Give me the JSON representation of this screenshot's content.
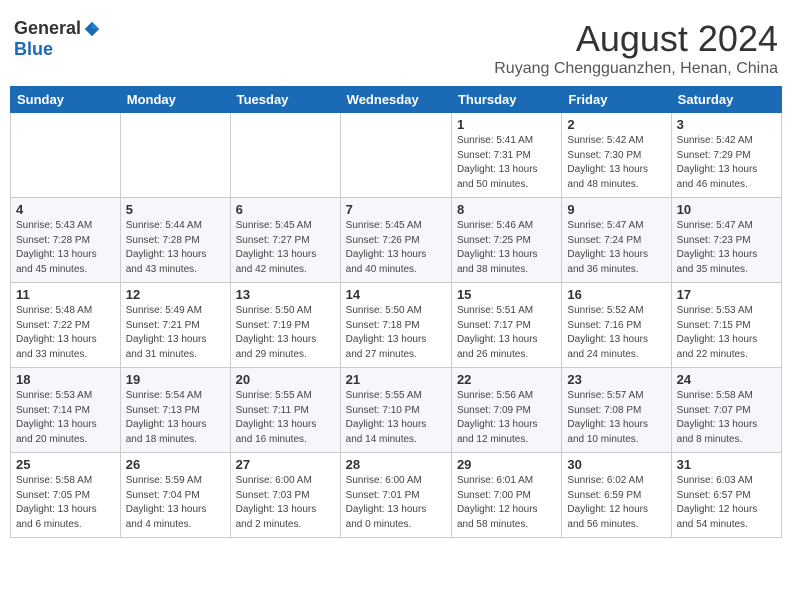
{
  "header": {
    "logo_general": "General",
    "logo_blue": "Blue",
    "month_title": "August 2024",
    "location": "Ruyang Chengguanzhen, Henan, China"
  },
  "days_of_week": [
    "Sunday",
    "Monday",
    "Tuesday",
    "Wednesday",
    "Thursday",
    "Friday",
    "Saturday"
  ],
  "weeks": [
    [
      {
        "day": "",
        "info": ""
      },
      {
        "day": "",
        "info": ""
      },
      {
        "day": "",
        "info": ""
      },
      {
        "day": "",
        "info": ""
      },
      {
        "day": "1",
        "info": "Sunrise: 5:41 AM\nSunset: 7:31 PM\nDaylight: 13 hours\nand 50 minutes."
      },
      {
        "day": "2",
        "info": "Sunrise: 5:42 AM\nSunset: 7:30 PM\nDaylight: 13 hours\nand 48 minutes."
      },
      {
        "day": "3",
        "info": "Sunrise: 5:42 AM\nSunset: 7:29 PM\nDaylight: 13 hours\nand 46 minutes."
      }
    ],
    [
      {
        "day": "4",
        "info": "Sunrise: 5:43 AM\nSunset: 7:28 PM\nDaylight: 13 hours\nand 45 minutes."
      },
      {
        "day": "5",
        "info": "Sunrise: 5:44 AM\nSunset: 7:28 PM\nDaylight: 13 hours\nand 43 minutes."
      },
      {
        "day": "6",
        "info": "Sunrise: 5:45 AM\nSunset: 7:27 PM\nDaylight: 13 hours\nand 42 minutes."
      },
      {
        "day": "7",
        "info": "Sunrise: 5:45 AM\nSunset: 7:26 PM\nDaylight: 13 hours\nand 40 minutes."
      },
      {
        "day": "8",
        "info": "Sunrise: 5:46 AM\nSunset: 7:25 PM\nDaylight: 13 hours\nand 38 minutes."
      },
      {
        "day": "9",
        "info": "Sunrise: 5:47 AM\nSunset: 7:24 PM\nDaylight: 13 hours\nand 36 minutes."
      },
      {
        "day": "10",
        "info": "Sunrise: 5:47 AM\nSunset: 7:23 PM\nDaylight: 13 hours\nand 35 minutes."
      }
    ],
    [
      {
        "day": "11",
        "info": "Sunrise: 5:48 AM\nSunset: 7:22 PM\nDaylight: 13 hours\nand 33 minutes."
      },
      {
        "day": "12",
        "info": "Sunrise: 5:49 AM\nSunset: 7:21 PM\nDaylight: 13 hours\nand 31 minutes."
      },
      {
        "day": "13",
        "info": "Sunrise: 5:50 AM\nSunset: 7:19 PM\nDaylight: 13 hours\nand 29 minutes."
      },
      {
        "day": "14",
        "info": "Sunrise: 5:50 AM\nSunset: 7:18 PM\nDaylight: 13 hours\nand 27 minutes."
      },
      {
        "day": "15",
        "info": "Sunrise: 5:51 AM\nSunset: 7:17 PM\nDaylight: 13 hours\nand 26 minutes."
      },
      {
        "day": "16",
        "info": "Sunrise: 5:52 AM\nSunset: 7:16 PM\nDaylight: 13 hours\nand 24 minutes."
      },
      {
        "day": "17",
        "info": "Sunrise: 5:53 AM\nSunset: 7:15 PM\nDaylight: 13 hours\nand 22 minutes."
      }
    ],
    [
      {
        "day": "18",
        "info": "Sunrise: 5:53 AM\nSunset: 7:14 PM\nDaylight: 13 hours\nand 20 minutes."
      },
      {
        "day": "19",
        "info": "Sunrise: 5:54 AM\nSunset: 7:13 PM\nDaylight: 13 hours\nand 18 minutes."
      },
      {
        "day": "20",
        "info": "Sunrise: 5:55 AM\nSunset: 7:11 PM\nDaylight: 13 hours\nand 16 minutes."
      },
      {
        "day": "21",
        "info": "Sunrise: 5:55 AM\nSunset: 7:10 PM\nDaylight: 13 hours\nand 14 minutes."
      },
      {
        "day": "22",
        "info": "Sunrise: 5:56 AM\nSunset: 7:09 PM\nDaylight: 13 hours\nand 12 minutes."
      },
      {
        "day": "23",
        "info": "Sunrise: 5:57 AM\nSunset: 7:08 PM\nDaylight: 13 hours\nand 10 minutes."
      },
      {
        "day": "24",
        "info": "Sunrise: 5:58 AM\nSunset: 7:07 PM\nDaylight: 13 hours\nand 8 minutes."
      }
    ],
    [
      {
        "day": "25",
        "info": "Sunrise: 5:58 AM\nSunset: 7:05 PM\nDaylight: 13 hours\nand 6 minutes."
      },
      {
        "day": "26",
        "info": "Sunrise: 5:59 AM\nSunset: 7:04 PM\nDaylight: 13 hours\nand 4 minutes."
      },
      {
        "day": "27",
        "info": "Sunrise: 6:00 AM\nSunset: 7:03 PM\nDaylight: 13 hours\nand 2 minutes."
      },
      {
        "day": "28",
        "info": "Sunrise: 6:00 AM\nSunset: 7:01 PM\nDaylight: 13 hours\nand 0 minutes."
      },
      {
        "day": "29",
        "info": "Sunrise: 6:01 AM\nSunset: 7:00 PM\nDaylight: 12 hours\nand 58 minutes."
      },
      {
        "day": "30",
        "info": "Sunrise: 6:02 AM\nSunset: 6:59 PM\nDaylight: 12 hours\nand 56 minutes."
      },
      {
        "day": "31",
        "info": "Sunrise: 6:03 AM\nSunset: 6:57 PM\nDaylight: 12 hours\nand 54 minutes."
      }
    ]
  ]
}
